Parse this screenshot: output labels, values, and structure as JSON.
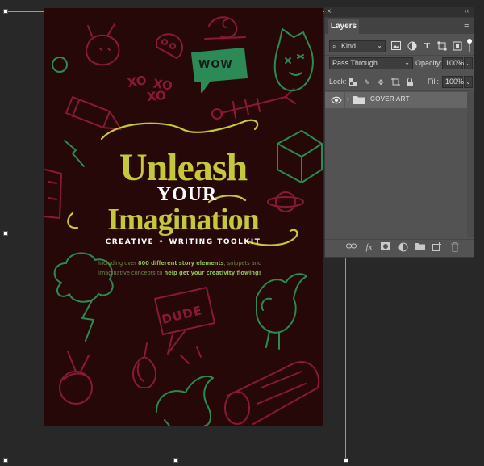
{
  "canvas": {
    "art": {
      "title_line1": "Unleash",
      "title_line2": "YOUR",
      "title_line3": "Imagination",
      "subtitle": "CREATIVE ✧ WRITING TOOLKIT",
      "desc_part1": "Including over ",
      "desc_bold1": "800 different story elements",
      "desc_part2": ", snippets and imaginative concepts to ",
      "desc_bold2": "help get your creativity flowing!",
      "bubble_text": "WOW",
      "xo_1": "XO",
      "xo_2": "XO",
      "xo_3": "XO",
      "sign_text": "DUDE",
      "colors": {
        "background": "#260808",
        "title": "#c4c83a",
        "doodle_red": "#8a1a33",
        "doodle_green": "#2c8a52",
        "bubble": "#2b8a55"
      }
    }
  },
  "layers_panel": {
    "top_close": "×",
    "top_collapse": "‹‹",
    "tab_label": "Layers",
    "menu_icon": "≡",
    "filter": {
      "kind_label": "Kind",
      "icons": [
        "image-filter-icon",
        "adjustment-filter-icon",
        "type-filter-icon",
        "shape-filter-icon",
        "smart-object-filter-icon"
      ]
    },
    "blend_mode": "Pass Through",
    "opacity_label": "Opacity:",
    "opacity_value": "100%",
    "lock_label": "Lock:",
    "fill_label": "Fill:",
    "fill_value": "100%",
    "layers": [
      {
        "name": "COVER ART",
        "type": "group",
        "visible": true,
        "expanded": false
      }
    ],
    "bottom_icons": [
      "link-layers-icon",
      "fx-icon",
      "mask-icon",
      "adjustment-layer-icon",
      "new-group-icon",
      "new-layer-icon",
      "delete-icon"
    ],
    "fx_label": "fx"
  }
}
